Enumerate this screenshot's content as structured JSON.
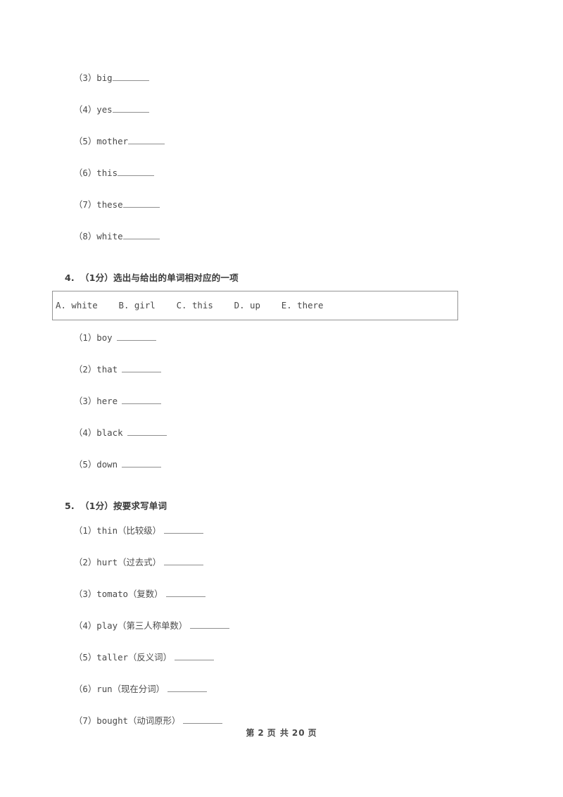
{
  "document": {
    "page_label_prefix": "第",
    "page_number": "2",
    "page_mid": "页 共",
    "page_total": "20",
    "page_suffix": "页",
    "footer_full": "第 2 页 共 20 页"
  },
  "questions": [
    {
      "id": "q3-continued",
      "items": [
        {
          "marker": "（3）",
          "word": "big"
        },
        {
          "marker": "（4）",
          "word": "yes"
        },
        {
          "marker": "（5）",
          "word": "mother"
        },
        {
          "marker": "（6）",
          "word": "this"
        },
        {
          "marker": "（7）",
          "word": "these"
        },
        {
          "marker": "（8）",
          "word": "white"
        }
      ]
    },
    {
      "id": "q4",
      "number": "4.",
      "score": "（1分）",
      "prompt": "选出与给出的单词相对应的一项",
      "option_box": {
        "text": "A. white    B. girl    C. this    D. up    E. there",
        "options": [
          {
            "letter": "A.",
            "word": "white"
          },
          {
            "letter": "B.",
            "word": "girl"
          },
          {
            "letter": "C.",
            "word": "this"
          },
          {
            "letter": "D.",
            "word": "up"
          },
          {
            "letter": "E.",
            "word": "there"
          }
        ]
      },
      "items": [
        {
          "marker": "（1）",
          "word": "boy"
        },
        {
          "marker": "（2）",
          "word": "that"
        },
        {
          "marker": "（3）",
          "word": "here"
        },
        {
          "marker": "（4）",
          "word": "black"
        },
        {
          "marker": "（5）",
          "word": "down"
        }
      ]
    },
    {
      "id": "q5",
      "number": "5.",
      "score": "（1分）",
      "prompt": "按要求写单词",
      "items": [
        {
          "marker": "（1）",
          "word": "thin",
          "hint": "（比较级）"
        },
        {
          "marker": "（2）",
          "word": "hurt",
          "hint": "（过去式）"
        },
        {
          "marker": "（3）",
          "word": "tomato",
          "hint": "（复数）"
        },
        {
          "marker": "（4）",
          "word": "play",
          "hint": "（第三人称单数）"
        },
        {
          "marker": "（5）",
          "word": "taller",
          "hint": "（反义词）"
        },
        {
          "marker": "（6）",
          "word": "run",
          "hint": "（现在分词）"
        },
        {
          "marker": "（7）",
          "word": "bought",
          "hint": "（动词原形）"
        }
      ]
    }
  ],
  "colors": {
    "text": "#4a4a4a",
    "rule": "#8f8f8f",
    "box_border": "#949494",
    "background": "#ffffff"
  }
}
